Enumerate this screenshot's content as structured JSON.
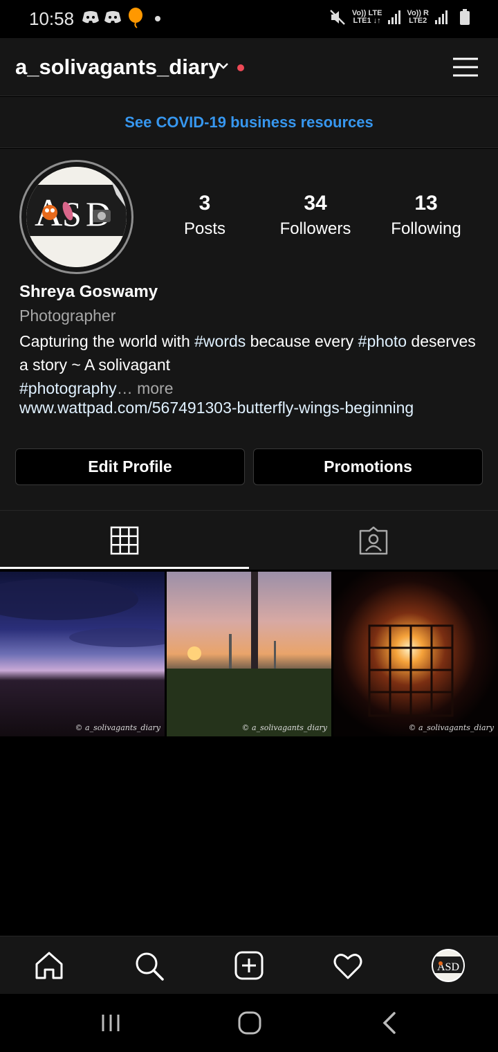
{
  "status_bar": {
    "time": "10:58",
    "sim1": "Vo)) LTE\nLTE1",
    "sim2": "Vo)) R\nLTE2",
    "icons": [
      "discord-icon",
      "discord-icon",
      "balloon-icon",
      "dot-icon",
      "mute-icon",
      "signal-icon",
      "battery-icon"
    ]
  },
  "header": {
    "username": "a_solivagants_diary"
  },
  "banner": {
    "text": "See COVID-19 business resources"
  },
  "profile": {
    "stats": [
      {
        "number": "3",
        "label": "Posts"
      },
      {
        "number": "34",
        "label": "Followers"
      },
      {
        "number": "13",
        "label": "Following"
      }
    ],
    "name": "Shreya Goswamy",
    "category": "Photographer",
    "bio_part1": "Capturing the world with ",
    "bio_tag1": "#words",
    "bio_part2": " because every ",
    "bio_tag2": "#photo",
    "bio_part3": " deserves a story ~ A solivagant",
    "bio_tag3": "#photography",
    "bio_more": "… more",
    "website": "www.wattpad.com/567491303-butterfly-wings-beginning",
    "avatar_text": "ASD"
  },
  "buttons": {
    "edit_profile": "Edit Profile",
    "promotions": "Promotions"
  },
  "posts": {
    "watermark": "© a_solivagants_diary"
  },
  "colors": {
    "link_blue": "#3797ef",
    "notification_red": "#ed4956",
    "background": "#000000",
    "surface": "#161616"
  }
}
